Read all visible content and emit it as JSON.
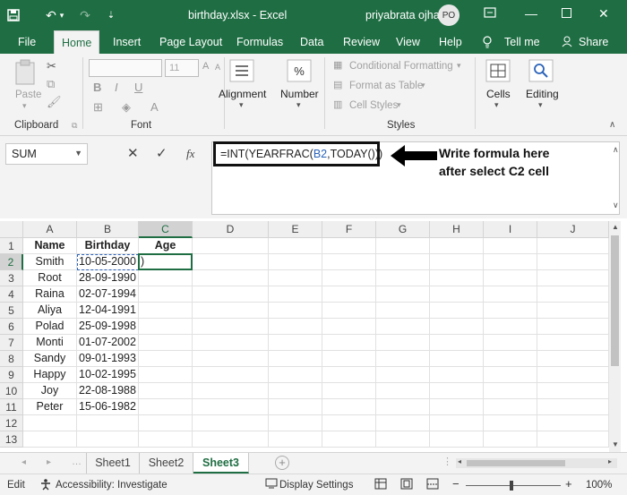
{
  "titlebar": {
    "filename": "birthday.xlsx",
    "dash": "-",
    "app": "Excel",
    "user": "priyabrata ojha",
    "avatar": "PO"
  },
  "tabs": [
    "File",
    "Home",
    "Insert",
    "Page Layout",
    "Formulas",
    "Data",
    "Review",
    "View",
    "Help"
  ],
  "tell_me": "Tell me",
  "share": "Share",
  "ribbon": {
    "clipboard": {
      "label": "Clipboard",
      "paste": "Paste"
    },
    "font": {
      "label": "Font",
      "size": "11",
      "bold": "B",
      "italic": "I",
      "underline": "U"
    },
    "alignment": "Alignment",
    "number": "Number",
    "styles": {
      "label": "Styles",
      "conditional": "Conditional Formatting",
      "format_table": "Format as Table",
      "cell_styles": "Cell Styles"
    },
    "cells": "Cells",
    "editing": "Editing"
  },
  "formula_bar": {
    "name_box": "SUM",
    "cancel": "✕",
    "enter": "✓",
    "fx": "fx",
    "formula_pre": "=INT(YEARFRAC(",
    "formula_ref": "B2",
    "formula_post": ",TODAY()))"
  },
  "annotation": {
    "line1": "Write formula here",
    "line2": "after select C2 cell"
  },
  "columns": [
    "A",
    "B",
    "C",
    "D",
    "E",
    "F",
    "G",
    "H",
    "I",
    "J"
  ],
  "rows": [
    "1",
    "2",
    "3",
    "4",
    "5",
    "6",
    "7",
    "8",
    "9",
    "10",
    "11",
    "12",
    "13"
  ],
  "table": {
    "headers": [
      "Name",
      "Birthday",
      "Age"
    ],
    "data": [
      [
        "Smith",
        "10-05-2000"
      ],
      [
        "Root",
        "28-09-1990"
      ],
      [
        "Raina",
        "02-07-1994"
      ],
      [
        "Aliya",
        "12-04-1991"
      ],
      [
        "Polad",
        "25-09-1998"
      ],
      [
        "Monti",
        "01-07-2002"
      ],
      [
        "Sandy",
        "09-01-1993"
      ],
      [
        "Happy",
        "10-02-1995"
      ],
      [
        "Joy",
        "22-08-1988"
      ],
      [
        "Peter",
        "15-06-1982"
      ]
    ],
    "active_cell_content": ")"
  },
  "sheets": [
    "Sheet1",
    "Sheet2",
    "Sheet3"
  ],
  "active_sheet": "Sheet3",
  "status": {
    "mode": "Edit",
    "accessibility": "Accessibility: Investigate",
    "display": "Display Settings",
    "zoom": "100%"
  },
  "colors": {
    "excel_green": "#1f6e43",
    "ref_blue": "#2b63b9"
  }
}
